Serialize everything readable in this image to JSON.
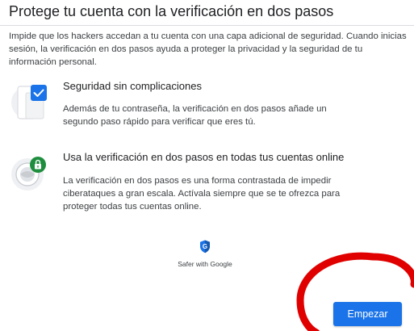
{
  "page": {
    "title": "Protege tu cuenta con la verificación en dos pasos",
    "intro": "Impide que los hackers accedan a tu cuenta con una capa adicional de seguridad. Cuando inicias sesión, la verificación en dos pasos ayuda a proteger la privacidad y la seguridad de tu información personal."
  },
  "features": [
    {
      "title": "Seguridad sin complicaciones",
      "description": "Además de tu contraseña, la verificación en dos pasos añade un segundo paso rápido para verificar que eres tú.",
      "icon": "checkbox-device-icon"
    },
    {
      "title": "Usa la verificación en dos pasos en todas tus cuentas online",
      "description": "La verificación en dos pasos es una forma contrastada de impedir ciberataques a gran escala. Actívala siempre que se te ofrezca para proteger todas tus cuentas online.",
      "icon": "lock-globe-icon"
    }
  ],
  "brand": {
    "text": "Safer with Google",
    "icon": "google-shield-icon"
  },
  "actions": {
    "start_label": "Empezar"
  },
  "colors": {
    "accent": "#1a73e8",
    "annotation": "#e00000",
    "lock_green": "#1e8e3e"
  }
}
